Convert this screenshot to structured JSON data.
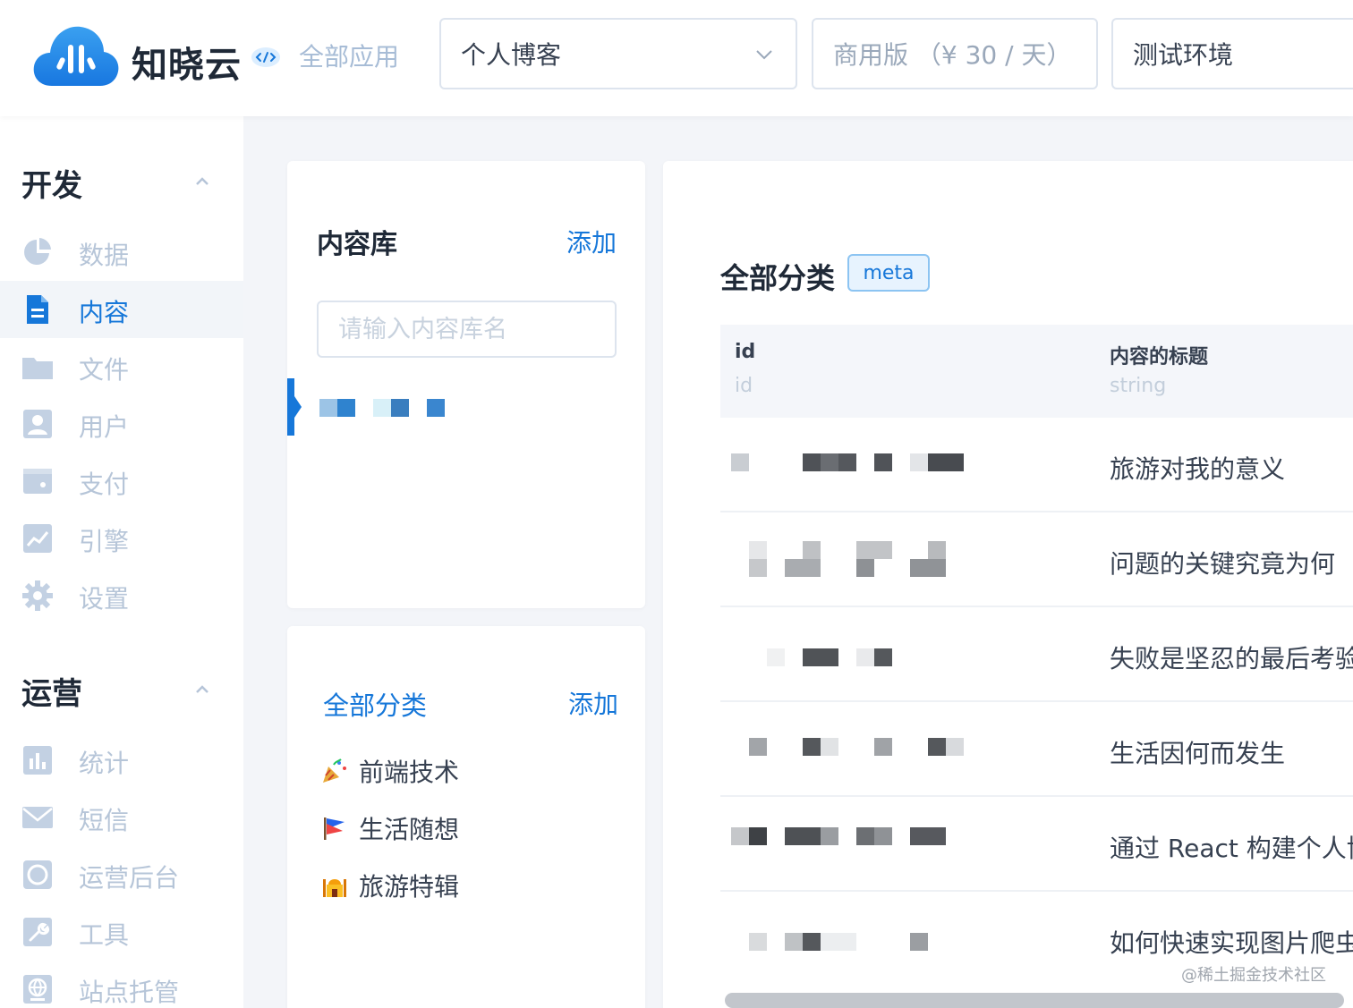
{
  "header": {
    "brand": "知晓云",
    "all_apps": "全部应用",
    "app_select": "个人博客",
    "plan": "商用版 （¥ 30 / 天）",
    "env": "测试环境"
  },
  "sidebar": {
    "groups": [
      {
        "title": "开发",
        "items": [
          {
            "label": "数据",
            "icon": "pie-chart-icon"
          },
          {
            "label": "内容",
            "icon": "document-icon",
            "active": true
          },
          {
            "label": "文件",
            "icon": "folder-icon"
          },
          {
            "label": "用户",
            "icon": "user-icon"
          },
          {
            "label": "支付",
            "icon": "wallet-icon"
          },
          {
            "label": "引擎",
            "icon": "line-chart-icon"
          },
          {
            "label": "设置",
            "icon": "gear-icon"
          }
        ]
      },
      {
        "title": "运营",
        "items": [
          {
            "label": "统计",
            "icon": "bar-chart-icon"
          },
          {
            "label": "短信",
            "icon": "mail-icon"
          },
          {
            "label": "运营后台",
            "icon": "console-icon"
          },
          {
            "label": "工具",
            "icon": "wrench-icon"
          },
          {
            "label": "站点托管",
            "icon": "globe-icon"
          }
        ]
      }
    ]
  },
  "library": {
    "title": "内容库",
    "add": "添加",
    "search_placeholder": "请输入内容库名"
  },
  "categories": {
    "all": "全部分类",
    "add": "添加",
    "items": [
      {
        "label": "前端技术",
        "icon": "party-popper-icon"
      },
      {
        "label": "生活随想",
        "icon": "flag-icon"
      },
      {
        "label": "旅游特辑",
        "icon": "mosque-icon"
      }
    ]
  },
  "content": {
    "title": "全部分类",
    "badge": "meta",
    "columns": [
      {
        "name": "id",
        "type": "id"
      },
      {
        "name": "内容的标题",
        "type": "string"
      }
    ],
    "rows": [
      {
        "title": "旅游对我的意义"
      },
      {
        "title": "问题的关键究竟为何"
      },
      {
        "title": "失败是坚忍的最后考验"
      },
      {
        "title": "生活因何而发生"
      },
      {
        "title": "通过 React 构建个人博客"
      },
      {
        "title": "如何快速实现图片爬虫"
      }
    ]
  },
  "watermark": "@稀土掘金技术社区",
  "colors": {
    "primary": "#1677d9",
    "sidebar_text": "#b6c5d8",
    "cloud": "#2b8ae8"
  }
}
